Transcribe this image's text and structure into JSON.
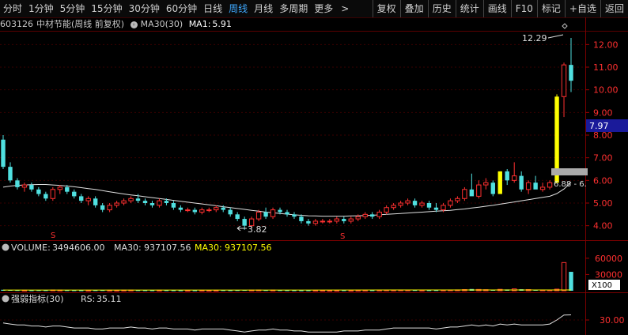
{
  "topbar": {
    "tabs": [
      "分时",
      "1分钟",
      "5分钟",
      "15分钟",
      "30分钟",
      "60分钟",
      "日线",
      "周线",
      "月线",
      "多周期",
      "更多"
    ],
    "active_tab": "周线",
    "more_arrow": ">",
    "right_tabs": [
      "复权",
      "叠加",
      "历史",
      "统计",
      "画线",
      "F10",
      "标记",
      "+自选",
      "返回"
    ]
  },
  "stock": {
    "code": "603126",
    "name": "中材节能",
    "period_note": "(周线 前复权)",
    "ma_label": "MA30(30)",
    "ma1_label": "MA1:",
    "ma1_value": "5.91"
  },
  "price_axis": {
    "ticks": [
      "12.00",
      "11.00",
      "10.00",
      "9.00",
      "8.00",
      "7.00",
      "6.00",
      "5.00",
      "4.00"
    ],
    "current_price_label": "7.97"
  },
  "annotations": {
    "high_label": "12.29",
    "low_label": "3.82",
    "range_label": "6.88 - 6.",
    "s_marker": "S"
  },
  "volume": {
    "label": "VOLUME:",
    "value": "3494606.00",
    "ma_label": "MA30:",
    "ma_value": "937107.56",
    "ma2_label": "MA30:",
    "ma2_value": "937107.56",
    "ticks": [
      "60000",
      "30000"
    ],
    "unit": "X100"
  },
  "rs": {
    "label": "强弱指标(30)",
    "rs_label": "RS:",
    "rs_value": "35.11",
    "ticks": [
      "30.00"
    ]
  },
  "colors": {
    "up": "#ff3030",
    "down": "#50e0e0",
    "ma": "#e0e0e0",
    "limit_up": "#ffff00",
    "accent": "#3fa9ff"
  },
  "chart_data": {
    "type": "candlestick",
    "ylim": [
      3.5,
      12.5
    ],
    "candles": [
      [
        7.8,
        8.0,
        6.5,
        6.6
      ],
      [
        6.6,
        6.8,
        5.9,
        6.0
      ],
      [
        6.0,
        6.1,
        5.6,
        5.7
      ],
      [
        5.7,
        5.9,
        5.5,
        5.8
      ],
      [
        5.8,
        5.9,
        5.5,
        5.6
      ],
      [
        5.6,
        5.7,
        5.3,
        5.4
      ],
      [
        5.4,
        5.5,
        5.1,
        5.2
      ],
      [
        5.2,
        5.7,
        5.1,
        5.6
      ],
      [
        5.6,
        5.8,
        5.4,
        5.7
      ],
      [
        5.7,
        5.8,
        5.4,
        5.5
      ],
      [
        5.5,
        5.6,
        5.2,
        5.3
      ],
      [
        5.3,
        5.4,
        5.0,
        5.1
      ],
      [
        5.1,
        5.3,
        4.9,
        5.2
      ],
      [
        5.2,
        5.3,
        4.8,
        4.9
      ],
      [
        4.9,
        5.0,
        4.6,
        4.7
      ],
      [
        4.7,
        5.0,
        4.6,
        4.9
      ],
      [
        4.9,
        5.1,
        4.8,
        5.0
      ],
      [
        5.0,
        5.2,
        4.9,
        5.1
      ],
      [
        5.1,
        5.3,
        5.0,
        5.2
      ],
      [
        5.2,
        5.4,
        5.0,
        5.1
      ],
      [
        5.1,
        5.2,
        4.9,
        5.0
      ],
      [
        5.0,
        5.1,
        4.8,
        4.9
      ],
      [
        4.9,
        5.2,
        4.8,
        5.1
      ],
      [
        5.1,
        5.2,
        4.9,
        5.0
      ],
      [
        5.0,
        5.1,
        4.7,
        4.8
      ],
      [
        4.8,
        4.9,
        4.6,
        4.7
      ],
      [
        4.7,
        4.8,
        4.6,
        4.7
      ],
      [
        4.7,
        4.8,
        4.5,
        4.6
      ],
      [
        4.6,
        4.8,
        4.5,
        4.7
      ],
      [
        4.7,
        4.8,
        4.6,
        4.7
      ],
      [
        4.7,
        4.9,
        4.6,
        4.8
      ],
      [
        4.8,
        4.9,
        4.6,
        4.7
      ],
      [
        4.7,
        4.8,
        4.4,
        4.5
      ],
      [
        4.5,
        4.6,
        4.2,
        4.3
      ],
      [
        4.3,
        4.4,
        3.82,
        4.0
      ],
      [
        4.0,
        4.4,
        3.9,
        4.3
      ],
      [
        4.3,
        4.7,
        4.2,
        4.6
      ],
      [
        4.6,
        4.8,
        4.3,
        4.4
      ],
      [
        4.4,
        4.8,
        4.3,
        4.7
      ],
      [
        4.7,
        4.8,
        4.5,
        4.6
      ],
      [
        4.6,
        4.7,
        4.4,
        4.5
      ],
      [
        4.5,
        4.6,
        4.3,
        4.4
      ],
      [
        4.4,
        4.5,
        4.1,
        4.2
      ],
      [
        4.2,
        4.3,
        4.0,
        4.1
      ],
      [
        4.1,
        4.3,
        4.0,
        4.2
      ],
      [
        4.2,
        4.3,
        4.1,
        4.2
      ],
      [
        4.2,
        4.3,
        4.1,
        4.2
      ],
      [
        4.2,
        4.4,
        4.1,
        4.3
      ],
      [
        4.3,
        4.4,
        4.1,
        4.2
      ],
      [
        4.2,
        4.4,
        4.1,
        4.3
      ],
      [
        4.3,
        4.5,
        4.2,
        4.4
      ],
      [
        4.4,
        4.6,
        4.3,
        4.5
      ],
      [
        4.5,
        4.6,
        4.3,
        4.4
      ],
      [
        4.4,
        4.7,
        4.3,
        4.6
      ],
      [
        4.6,
        4.9,
        4.5,
        4.8
      ],
      [
        4.8,
        5.0,
        4.7,
        4.9
      ],
      [
        4.9,
        5.1,
        4.8,
        5.0
      ],
      [
        5.0,
        5.2,
        4.9,
        5.1
      ],
      [
        5.1,
        5.2,
        4.8,
        4.9
      ],
      [
        4.9,
        5.1,
        4.8,
        5.0
      ],
      [
        5.0,
        5.1,
        4.7,
        4.8
      ],
      [
        4.8,
        5.0,
        4.6,
        4.7
      ],
      [
        4.7,
        5.0,
        4.6,
        4.9
      ],
      [
        4.9,
        5.2,
        4.8,
        5.1
      ],
      [
        5.1,
        5.3,
        5.0,
        5.2
      ],
      [
        5.2,
        5.7,
        5.1,
        5.6
      ],
      [
        5.6,
        6.3,
        5.5,
        5.3
      ],
      [
        5.3,
        6.0,
        5.2,
        5.8
      ],
      [
        5.8,
        6.1,
        5.6,
        5.9
      ],
      [
        5.9,
        6.0,
        5.3,
        5.4
      ],
      [
        5.4,
        6.4,
        5.4,
        6.4
      ],
      [
        6.4,
        6.5,
        5.8,
        6.0
      ],
      [
        6.0,
        6.8,
        5.9,
        6.2
      ],
      [
        6.2,
        6.4,
        5.5,
        5.6
      ],
      [
        5.6,
        6.0,
        5.4,
        5.9
      ],
      [
        5.9,
        6.2,
        5.7,
        5.6
      ],
      [
        5.6,
        5.9,
        5.5,
        5.7
      ],
      [
        5.7,
        6.0,
        5.6,
        5.9
      ],
      [
        5.9,
        9.8,
        5.9,
        9.7
      ],
      [
        9.7,
        11.2,
        8.8,
        11.1
      ],
      [
        11.1,
        12.29,
        9.9,
        10.4
      ]
    ],
    "ma30": [
      5.7,
      5.75,
      5.78,
      5.8,
      5.81,
      5.82,
      5.82,
      5.8,
      5.78,
      5.75,
      5.72,
      5.68,
      5.64,
      5.6,
      5.55,
      5.5,
      5.45,
      5.4,
      5.36,
      5.32,
      5.28,
      5.24,
      5.2,
      5.16,
      5.12,
      5.08,
      5.04,
      5.0,
      4.96,
      4.92,
      4.88,
      4.84,
      4.8,
      4.76,
      4.72,
      4.68,
      4.64,
      4.6,
      4.57,
      4.54,
      4.51,
      4.48,
      4.46,
      4.44,
      4.43,
      4.42,
      4.42,
      4.42,
      4.42,
      4.43,
      4.44,
      4.45,
      4.46,
      4.48,
      4.5,
      4.52,
      4.54,
      4.56,
      4.58,
      4.6,
      4.62,
      4.64,
      4.66,
      4.68,
      4.71,
      4.74,
      4.78,
      4.82,
      4.86,
      4.9,
      4.95,
      5.0,
      5.05,
      5.1,
      5.15,
      5.2,
      5.25,
      5.3,
      5.42,
      5.62,
      5.91
    ],
    "volume": [
      1800,
      1500,
      1200,
      1000,
      900,
      1100,
      1000,
      1400,
      1200,
      1000,
      900,
      800,
      900,
      1000,
      1100,
      1000,
      900,
      1100,
      1200,
      1000,
      900,
      800,
      1000,
      900,
      800,
      700,
      800,
      700,
      900,
      800,
      900,
      1000,
      900,
      1100,
      1300,
      1200,
      1400,
      1100,
      1200,
      1000,
      900,
      800,
      700,
      800,
      900,
      800,
      700,
      800,
      900,
      800,
      1000,
      1100,
      900,
      1200,
      1400,
      1300,
      1500,
      1400,
      1200,
      1100,
      1000,
      1100,
      1300,
      1500,
      1600,
      2200,
      3200,
      2400,
      2000,
      1800,
      2600,
      2400,
      3500,
      2800,
      2200,
      2000,
      1500,
      1400,
      3000,
      52000,
      34946
    ],
    "rs": [
      27,
      26,
      25,
      25,
      24,
      24,
      23,
      24,
      24,
      23,
      22,
      22,
      22,
      21,
      21,
      22,
      22,
      22,
      23,
      22,
      22,
      21,
      22,
      22,
      21,
      21,
      21,
      20,
      21,
      21,
      21,
      21,
      20,
      19,
      18,
      19,
      20,
      20,
      21,
      20,
      20,
      19,
      19,
      18,
      18,
      18,
      18,
      18,
      19,
      19,
      19,
      20,
      20,
      20,
      21,
      22,
      22,
      22,
      22,
      22,
      22,
      21,
      22,
      23,
      23,
      24,
      25,
      24,
      25,
      24,
      26,
      25,
      26,
      25,
      25,
      25,
      25,
      26,
      30,
      35,
      35.11
    ],
    "rs_ylim": [
      15,
      45
    ],
    "volume_ylim": [
      0,
      70000
    ]
  }
}
